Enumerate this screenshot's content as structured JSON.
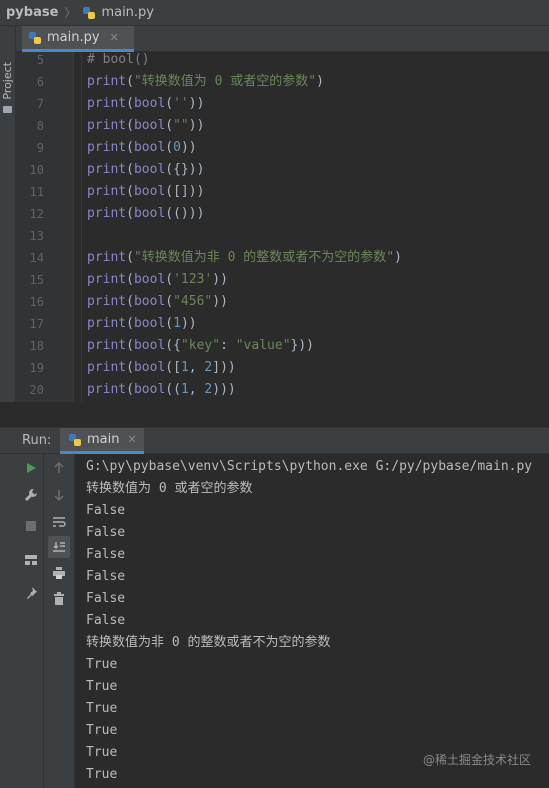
{
  "navbar": {
    "project": "pybase",
    "file": "main.py"
  },
  "stripe": {
    "project_label": "Project"
  },
  "editor": {
    "tab_label": "main.py",
    "lines": [
      {
        "n": "5",
        "code": [
          {
            "t": "# bool()",
            "c": "cmt"
          }
        ]
      },
      {
        "n": "6",
        "code": [
          {
            "t": "print",
            "c": "fn"
          },
          {
            "t": "(",
            "c": ""
          },
          {
            "t": "\"转换数值为 0 或者空的参数\"",
            "c": "str"
          },
          {
            "t": ")",
            "c": ""
          }
        ]
      },
      {
        "n": "7",
        "code": [
          {
            "t": "print",
            "c": "fn"
          },
          {
            "t": "(",
            "c": ""
          },
          {
            "t": "bool",
            "c": "fn"
          },
          {
            "t": "(",
            "c": ""
          },
          {
            "t": "''",
            "c": "str"
          },
          {
            "t": "))",
            "c": ""
          }
        ]
      },
      {
        "n": "8",
        "code": [
          {
            "t": "print",
            "c": "fn"
          },
          {
            "t": "(",
            "c": ""
          },
          {
            "t": "bool",
            "c": "fn"
          },
          {
            "t": "(",
            "c": ""
          },
          {
            "t": "\"\"",
            "c": "str"
          },
          {
            "t": "))",
            "c": ""
          }
        ]
      },
      {
        "n": "9",
        "code": [
          {
            "t": "print",
            "c": "fn"
          },
          {
            "t": "(",
            "c": ""
          },
          {
            "t": "bool",
            "c": "fn"
          },
          {
            "t": "(",
            "c": ""
          },
          {
            "t": "0",
            "c": "num"
          },
          {
            "t": "))",
            "c": ""
          }
        ]
      },
      {
        "n": "10",
        "code": [
          {
            "t": "print",
            "c": "fn"
          },
          {
            "t": "(",
            "c": ""
          },
          {
            "t": "bool",
            "c": "fn"
          },
          {
            "t": "({}))",
            "c": ""
          }
        ]
      },
      {
        "n": "11",
        "code": [
          {
            "t": "print",
            "c": "fn"
          },
          {
            "t": "(",
            "c": ""
          },
          {
            "t": "bool",
            "c": "fn"
          },
          {
            "t": "([]))",
            "c": ""
          }
        ]
      },
      {
        "n": "12",
        "code": [
          {
            "t": "print",
            "c": "fn"
          },
          {
            "t": "(",
            "c": ""
          },
          {
            "t": "bool",
            "c": "fn"
          },
          {
            "t": "(()))",
            "c": ""
          }
        ]
      },
      {
        "n": "13",
        "code": []
      },
      {
        "n": "14",
        "code": [
          {
            "t": "print",
            "c": "fn"
          },
          {
            "t": "(",
            "c": ""
          },
          {
            "t": "\"转换数值为非 0 的整数或者不为空的参数\"",
            "c": "str"
          },
          {
            "t": ")",
            "c": ""
          }
        ]
      },
      {
        "n": "15",
        "code": [
          {
            "t": "print",
            "c": "fn"
          },
          {
            "t": "(",
            "c": ""
          },
          {
            "t": "bool",
            "c": "fn"
          },
          {
            "t": "(",
            "c": ""
          },
          {
            "t": "'123'",
            "c": "str"
          },
          {
            "t": "))",
            "c": ""
          }
        ]
      },
      {
        "n": "16",
        "code": [
          {
            "t": "print",
            "c": "fn"
          },
          {
            "t": "(",
            "c": ""
          },
          {
            "t": "bool",
            "c": "fn"
          },
          {
            "t": "(",
            "c": ""
          },
          {
            "t": "\"456\"",
            "c": "str"
          },
          {
            "t": "))",
            "c": ""
          }
        ]
      },
      {
        "n": "17",
        "code": [
          {
            "t": "print",
            "c": "fn"
          },
          {
            "t": "(",
            "c": ""
          },
          {
            "t": "bool",
            "c": "fn"
          },
          {
            "t": "(",
            "c": ""
          },
          {
            "t": "1",
            "c": "num"
          },
          {
            "t": "))",
            "c": ""
          }
        ]
      },
      {
        "n": "18",
        "code": [
          {
            "t": "print",
            "c": "fn"
          },
          {
            "t": "(",
            "c": ""
          },
          {
            "t": "bool",
            "c": "fn"
          },
          {
            "t": "({",
            "c": ""
          },
          {
            "t": "\"key\"",
            "c": "str"
          },
          {
            "t": ": ",
            "c": ""
          },
          {
            "t": "\"value\"",
            "c": "str"
          },
          {
            "t": "}))",
            "c": ""
          }
        ]
      },
      {
        "n": "19",
        "code": [
          {
            "t": "print",
            "c": "fn"
          },
          {
            "t": "(",
            "c": ""
          },
          {
            "t": "bool",
            "c": "fn"
          },
          {
            "t": "([",
            "c": ""
          },
          {
            "t": "1",
            "c": "num"
          },
          {
            "t": ", ",
            "c": ""
          },
          {
            "t": "2",
            "c": "num"
          },
          {
            "t": "]))",
            "c": ""
          }
        ]
      },
      {
        "n": "20",
        "code": [
          {
            "t": "print",
            "c": "fn"
          },
          {
            "t": "(",
            "c": ""
          },
          {
            "t": "bool",
            "c": "fn"
          },
          {
            "t": "((",
            "c": ""
          },
          {
            "t": "1",
            "c": "num"
          },
          {
            "t": ", ",
            "c": ""
          },
          {
            "t": "2",
            "c": "num"
          },
          {
            "t": ")))",
            "c": ""
          }
        ]
      }
    ]
  },
  "run": {
    "label": "Run:",
    "tab_label": "main",
    "output": [
      "G:\\py\\pybase\\venv\\Scripts\\python.exe G:/py/pybase/main.py",
      "转换数值为 0 或者空的参数",
      "False",
      "False",
      "False",
      "False",
      "False",
      "False",
      "转换数值为非 0 的整数或者不为空的参数",
      "True",
      "True",
      "True",
      "True",
      "True",
      "True"
    ]
  },
  "watermark": "@稀土掘金技术社区",
  "colors": {
    "accent": "#4a88c7",
    "run_green": "#499c54",
    "string": "#6a8759",
    "builtin": "#8888c6",
    "number": "#6897bb",
    "comment": "#808080"
  }
}
